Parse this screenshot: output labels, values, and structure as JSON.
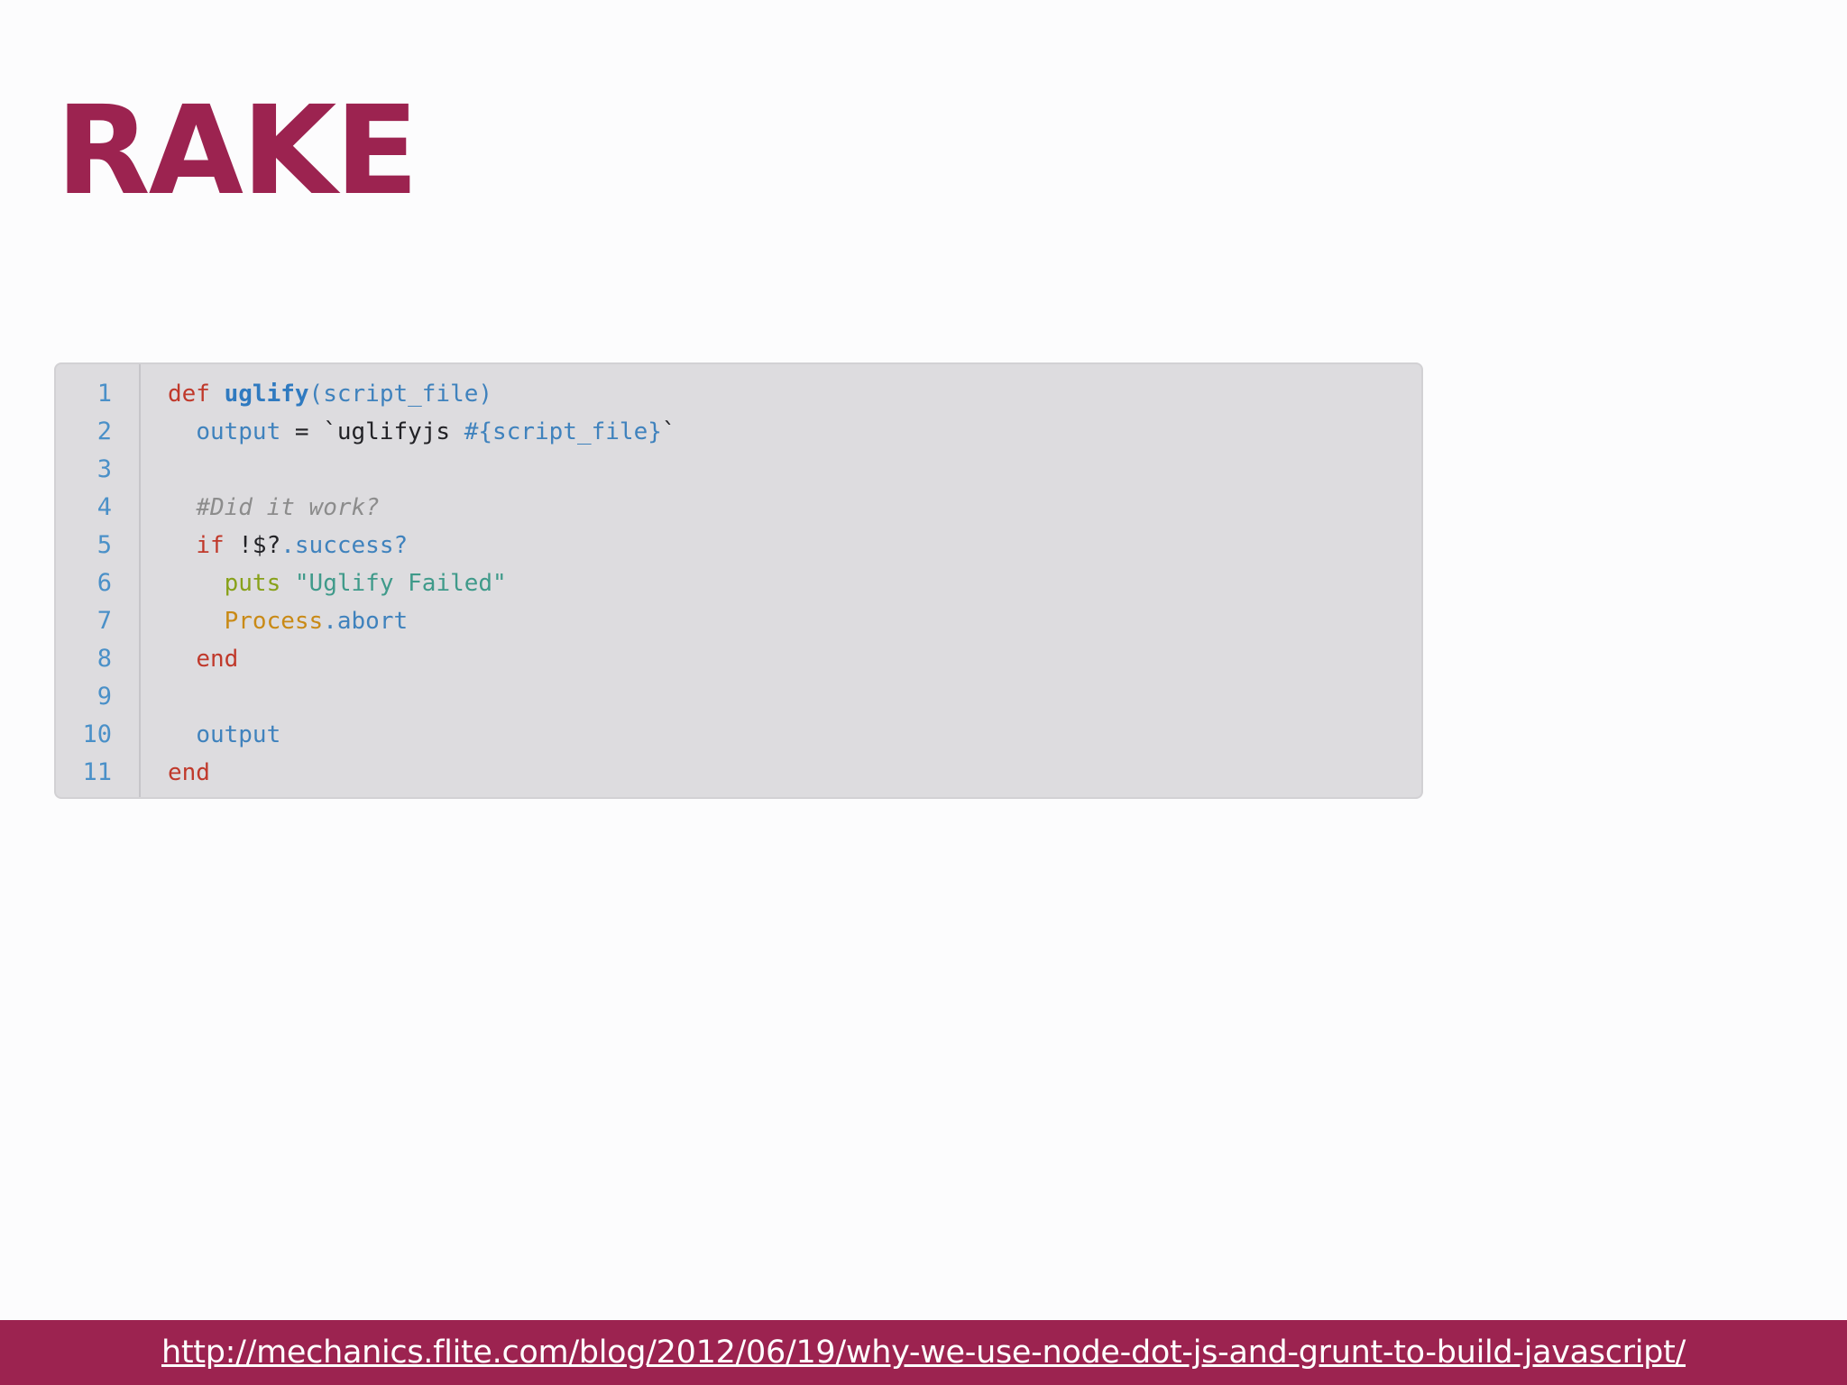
{
  "slide": {
    "title": "RAKE"
  },
  "code": {
    "line_numbers": [
      "1",
      "2",
      "3",
      "4",
      "5",
      "6",
      "7",
      "8",
      "9",
      "10",
      "11"
    ],
    "lines": [
      [
        {
          "t": "kw",
          "s": "def"
        },
        {
          "t": "plain",
          "s": " "
        },
        {
          "t": "fn",
          "s": "uglify"
        },
        {
          "t": "var",
          "s": "(script_file)"
        }
      ],
      [
        {
          "t": "plain",
          "s": "  "
        },
        {
          "t": "var",
          "s": "output"
        },
        {
          "t": "plain",
          "s": " = `uglifyjs "
        },
        {
          "t": "interp",
          "s": "#{script_file}"
        },
        {
          "t": "plain",
          "s": "`"
        }
      ],
      [],
      [
        {
          "t": "plain",
          "s": "  "
        },
        {
          "t": "comment",
          "s": "#Did it work?"
        }
      ],
      [
        {
          "t": "plain",
          "s": "  "
        },
        {
          "t": "kw",
          "s": "if"
        },
        {
          "t": "plain",
          "s": " !$?"
        },
        {
          "t": "var",
          "s": ".success?"
        }
      ],
      [
        {
          "t": "plain",
          "s": "    "
        },
        {
          "t": "puts",
          "s": "puts"
        },
        {
          "t": "plain",
          "s": " "
        },
        {
          "t": "str",
          "s": "\"Uglify Failed\""
        }
      ],
      [
        {
          "t": "plain",
          "s": "    "
        },
        {
          "t": "const",
          "s": "Process"
        },
        {
          "t": "var",
          "s": ".abort"
        }
      ],
      [
        {
          "t": "plain",
          "s": "  "
        },
        {
          "t": "kw",
          "s": "end"
        }
      ],
      [],
      [
        {
          "t": "plain",
          "s": "  "
        },
        {
          "t": "var",
          "s": "output"
        }
      ],
      [
        {
          "t": "kw",
          "s": "end"
        }
      ]
    ]
  },
  "footer": {
    "link_text": "http://mechanics.flite.com/blog/2012/06/19/why-we-use-node-dot-js-and-grunt-to-build-javascript/"
  },
  "colors": {
    "accent": "#9c2350",
    "code_background": "#dddcdf",
    "line_number": "#4a90c8"
  }
}
